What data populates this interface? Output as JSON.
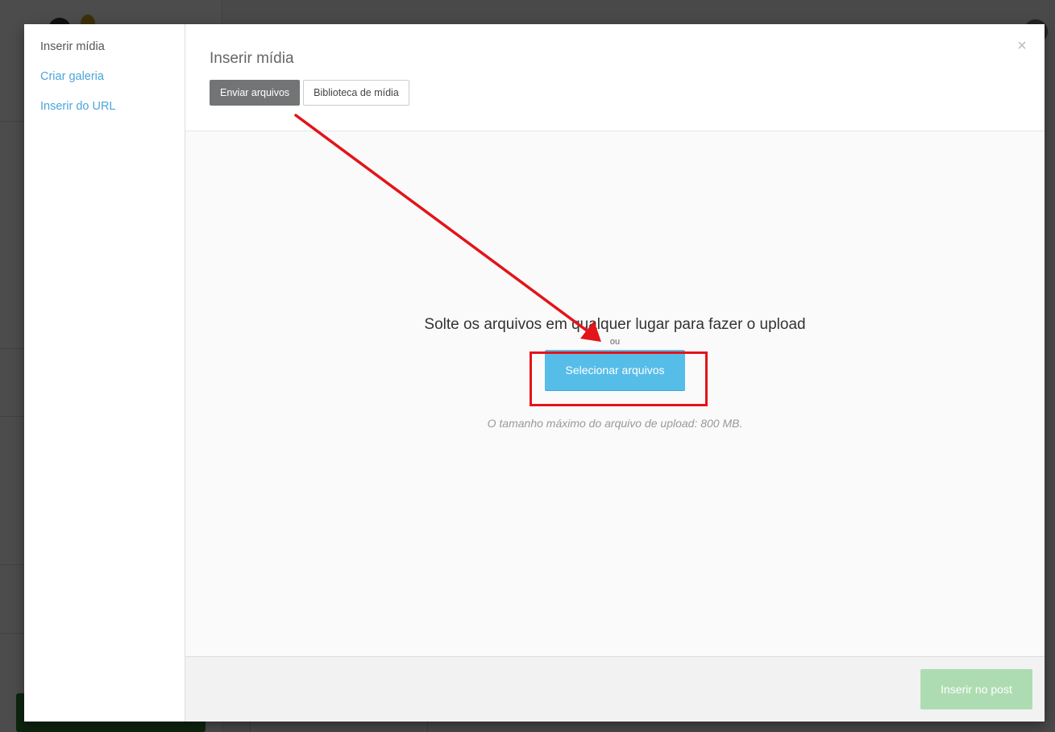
{
  "modal": {
    "menu": {
      "items": [
        {
          "label": "Inserir mídia",
          "active": true
        },
        {
          "label": "Criar galeria",
          "active": false
        },
        {
          "label": "Inserir do URL",
          "active": false
        }
      ]
    },
    "title": "Inserir mídia",
    "close_label": "×",
    "tabs": [
      {
        "label": "Enviar arquivos",
        "active": true
      },
      {
        "label": "Biblioteca de mídia",
        "active": false
      }
    ],
    "uploader": {
      "drop_text": "Solte os arquivos em qualquer lugar para fazer o upload",
      "or_text": "ou",
      "select_button": "Selecionar arquivos",
      "max_size_text": "O tamanho máximo do arquivo de upload: 800 MB."
    },
    "toolbar": {
      "insert_button": "Inserir no post"
    }
  },
  "colors": {
    "link": "#4aa6d8",
    "tab_active": "#737475",
    "select_button": "#56bde8",
    "insert_button_disabled": "#aedcb2",
    "annotation": "#e3141a"
  }
}
